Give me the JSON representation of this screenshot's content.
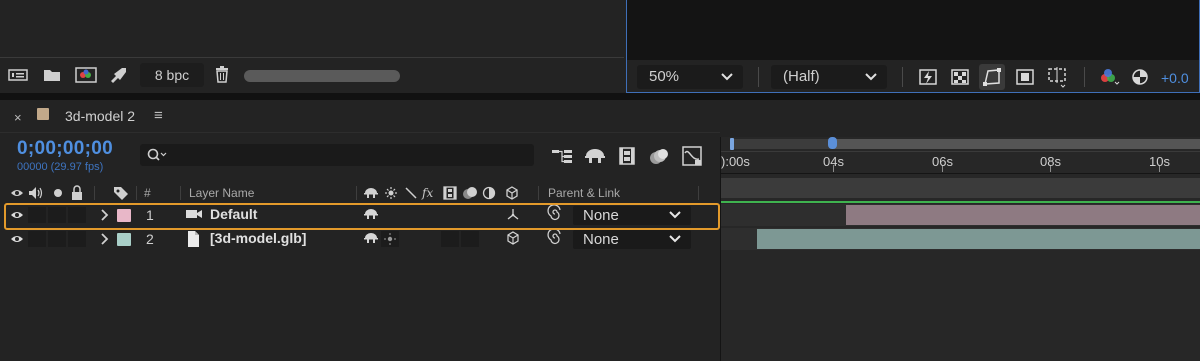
{
  "project": {
    "bpc_label": "8 bpc",
    "icons": [
      "interpret-footage-icon",
      "new-folder-icon",
      "new-composition-icon",
      "render-queue-icon",
      "trash-icon"
    ]
  },
  "viewer": {
    "zoom_value": "50%",
    "resolution_value": "(Half)",
    "exposure_value": "+0.0",
    "icons": [
      "fast-previews-icon",
      "transparency-grid-icon",
      "mask-visibility-icon",
      "region-of-interest-icon",
      "guides-grid-icon",
      "color-channels-icon",
      "reset-exposure-icon"
    ]
  },
  "timeline": {
    "close_glyph": "×",
    "comp_swatch_color": "#c2a98a",
    "comp_name": "3d-model 2",
    "menu_glyph": "≡",
    "timecode": "0;00;00;00",
    "fps_text": "00000 (29.97 fps)",
    "search_placeholder": "",
    "columns": {
      "number": "#",
      "layer_name": "Layer Name",
      "parent_link": "Parent & Link"
    },
    "ruler": {
      "labels": [
        "):00s",
        "04s",
        "06s",
        "08s",
        "10s"
      ],
      "label_0": "):00s",
      "label_1": "04s",
      "label_2": "06s",
      "label_3": "08s",
      "label_4": "10s"
    },
    "layers": [
      {
        "number": "1",
        "name": "Default",
        "label_color": "#e8b7c8",
        "type_icon": "camera-icon",
        "parent": "None",
        "selected": true,
        "bar_color": "#8e7a82",
        "bar_start_frac": 0.26,
        "bar_end_frac": 1.0
      },
      {
        "number": "2",
        "name": "[3d-model.glb]",
        "label_color": "#a9cfc8",
        "type_icon": "file-icon",
        "parent": "None",
        "selected": false,
        "bar_color": "#7d9894",
        "bar_start_frac": 0.075,
        "bar_end_frac": 1.0
      }
    ]
  }
}
